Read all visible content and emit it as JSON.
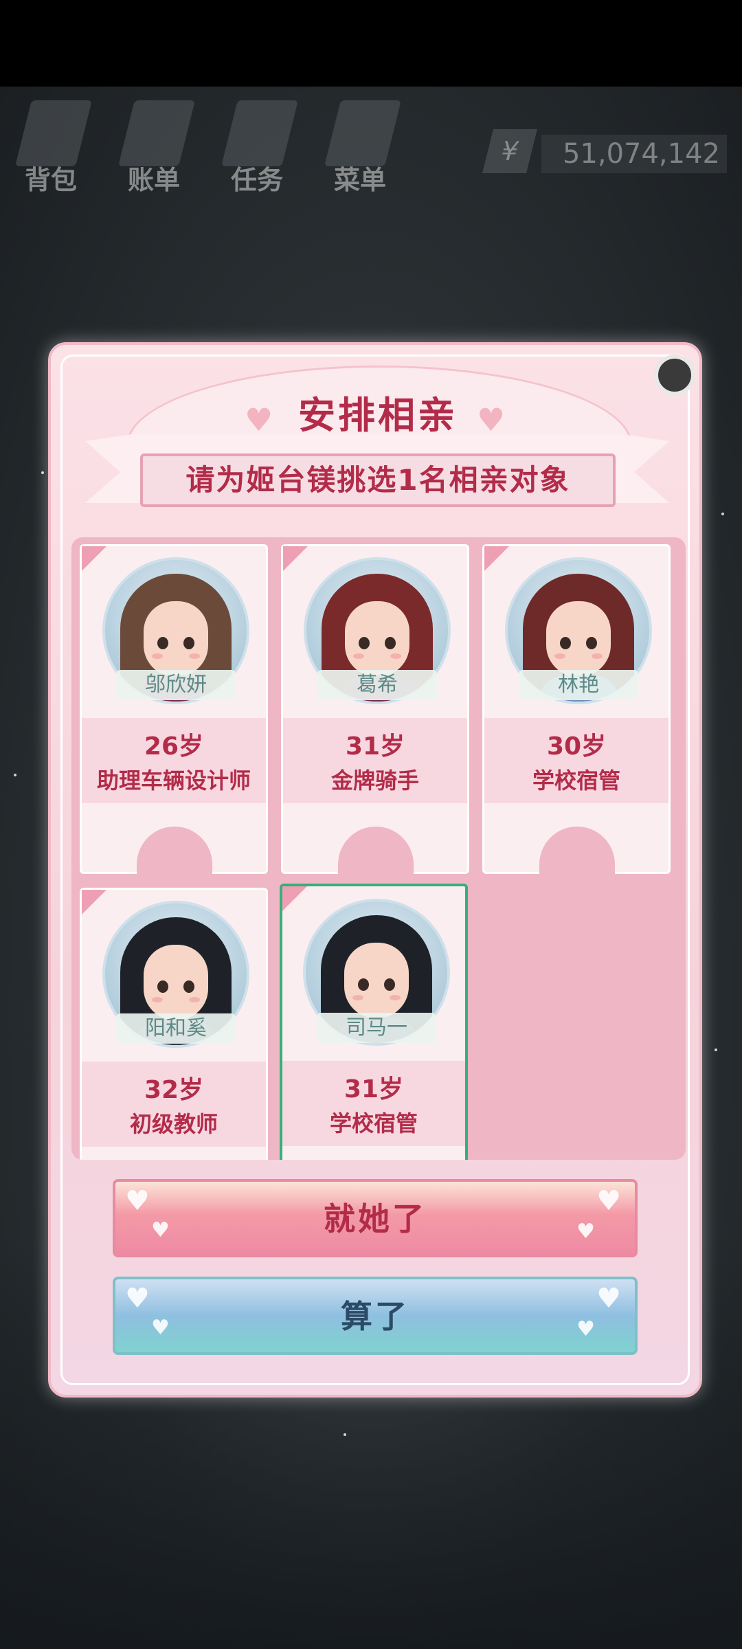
{
  "hud": {
    "items": [
      {
        "label": "背包",
        "icon": "bag-icon"
      },
      {
        "label": "账单",
        "icon": "bill-icon"
      },
      {
        "label": "任务",
        "icon": "task-icon"
      },
      {
        "label": "菜单",
        "icon": "menu-icon"
      }
    ],
    "currency_icon": "¥",
    "money": "51,074,142"
  },
  "dialog": {
    "title": "安排相亲",
    "subtitle": "请为姬台镁挑选1名相亲对象",
    "candidates": [
      {
        "name": "邬欣妍",
        "age": "26岁",
        "job": "助理车辆设计师",
        "selected": false
      },
      {
        "name": "葛希",
        "age": "31岁",
        "job": "金牌骑手",
        "selected": false
      },
      {
        "name": "林艳",
        "age": "30岁",
        "job": "学校宿管",
        "selected": false
      },
      {
        "name": "阳和奚",
        "age": "32岁",
        "job": "初级教师",
        "selected": false
      },
      {
        "name": "司马一",
        "age": "31岁",
        "job": "学校宿管",
        "selected": true
      }
    ],
    "confirm_label": "就她了",
    "cancel_label": "算了"
  },
  "colors": {
    "accent": "#b22c4a",
    "selected_border": "#35b07a"
  }
}
